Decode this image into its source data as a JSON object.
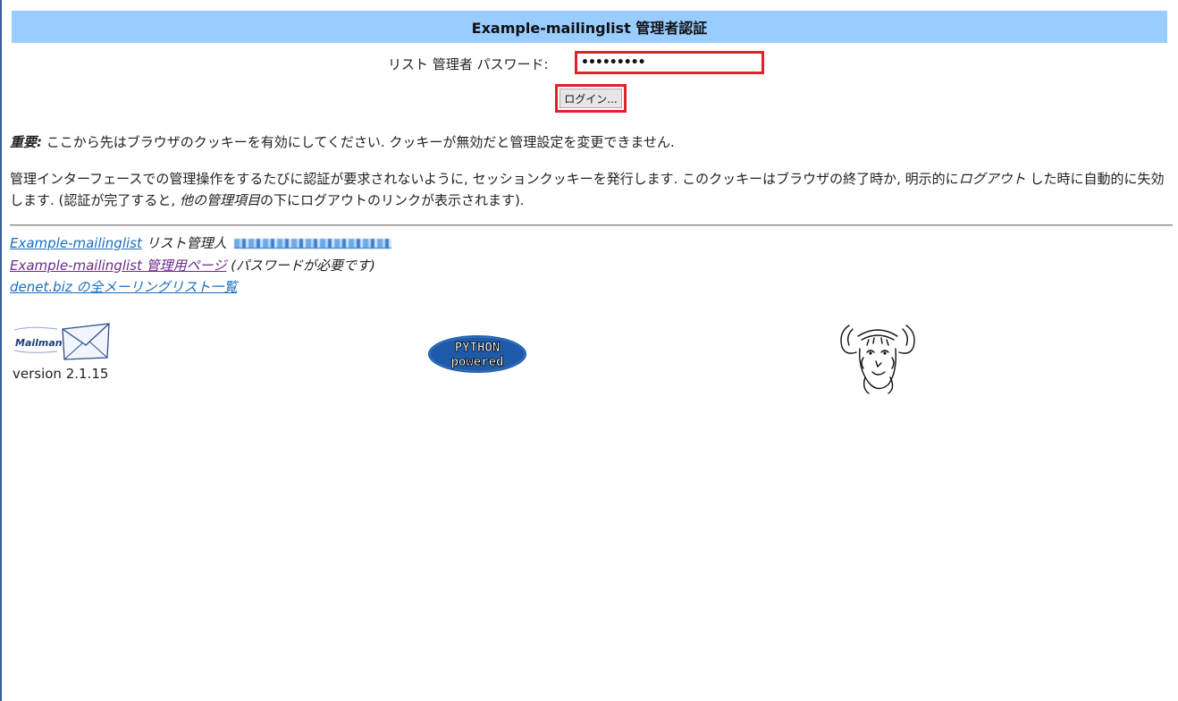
{
  "header": {
    "title": "Example-mailinglist 管理者認証"
  },
  "login": {
    "password_label": "リスト 管理者 パスワード:",
    "password_value": "•••••••••",
    "login_button": "ログイン..."
  },
  "notice": {
    "important_label": "重要:",
    "important_text": " ここから先はブラウザのクッキーを有効にしてください. クッキーが無効だと管理設定を変更できません.",
    "cookie_part1": "管理インターフェースでの管理操作をするたびに認証が要求されないように, セッションクッキーを発行します.  このクッキーはブラウザの終了時か, 明示的に",
    "cookie_logout_em": "ログアウト",
    "cookie_part2": " した時に自動的に失効します.  (認証が完了すると, ",
    "cookie_other_em": "他の管理項目",
    "cookie_part3": "の下にログアウトのリンクが表示されます)."
  },
  "footer": {
    "list_link": "Example-mailinglist",
    "list_admin_label": " リスト管理人 ",
    "admin_page_link": "Example-mailinglist 管理用ページ",
    "admin_page_note": " (パスワードが必要です)",
    "all_lists_link": "denet.biz の全メーリングリスト一覧",
    "version": "version 2.1.15"
  },
  "logos": {
    "mailman_text": "Mailman",
    "python_line1": "PYTHON",
    "python_line2": "powered"
  },
  "colors": {
    "header_bg": "#99ccff",
    "highlight_red": "#e0202a",
    "link_blue": "#1a6ec0",
    "link_visited": "#6a2a8a"
  }
}
